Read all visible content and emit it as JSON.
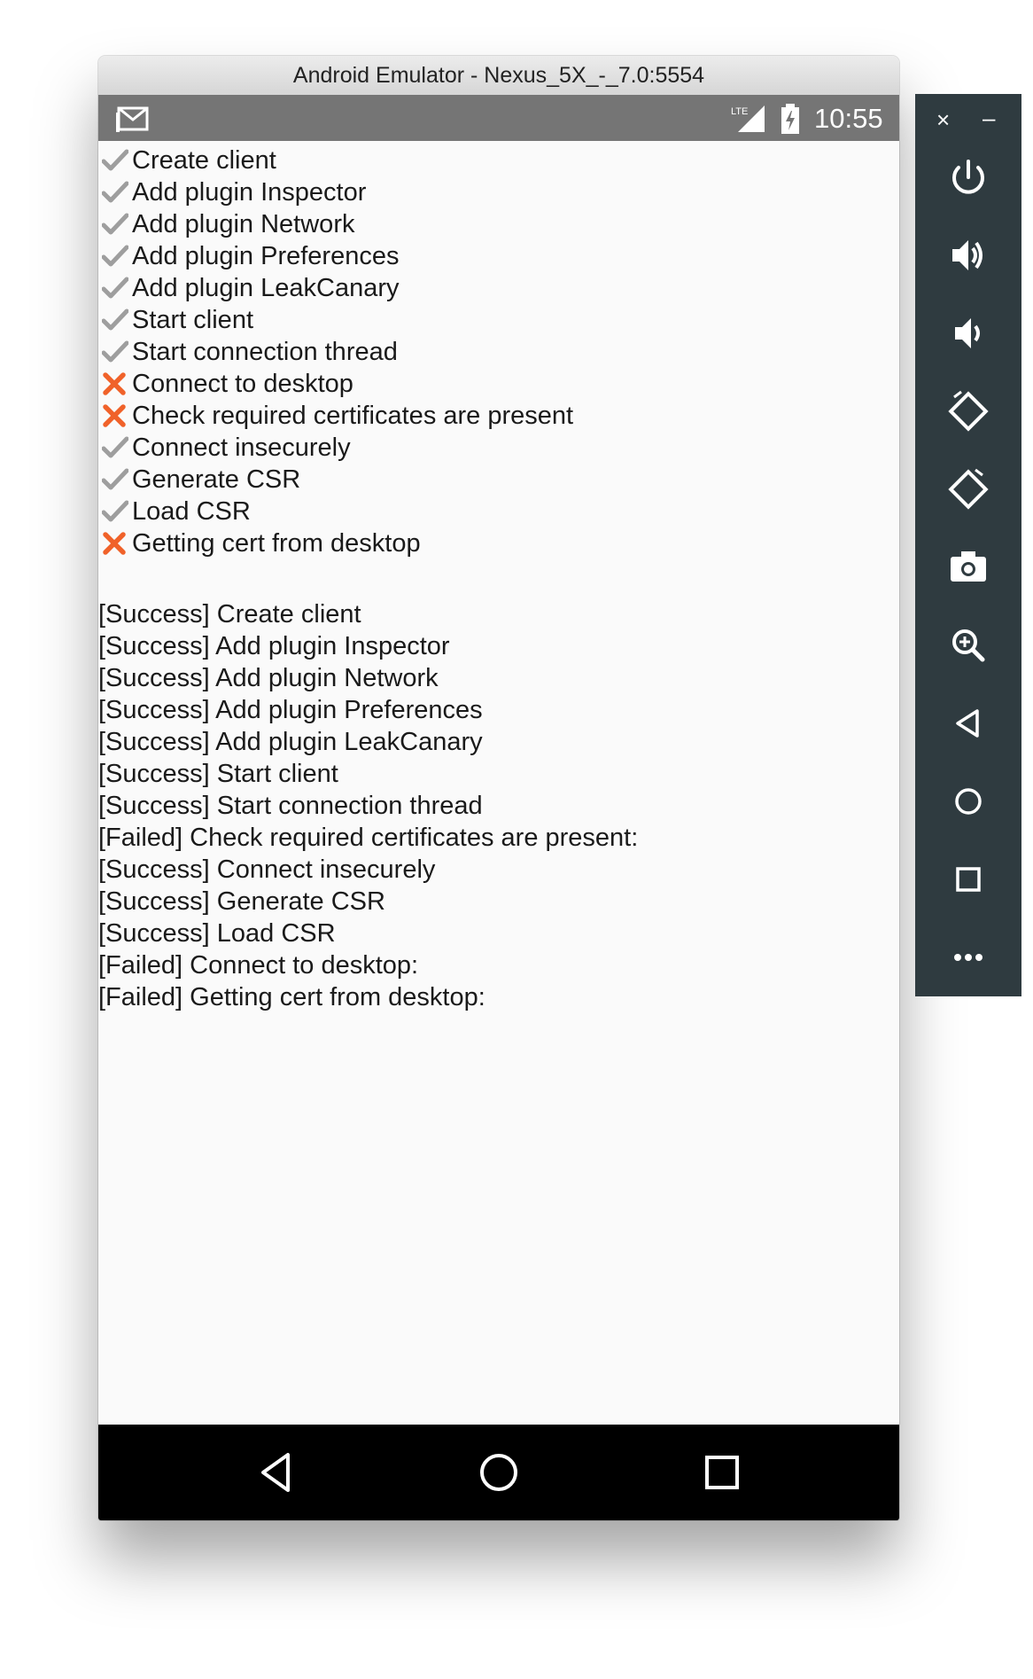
{
  "window": {
    "title": "Android Emulator - Nexus_5X_-_7.0:5554"
  },
  "statusbar": {
    "time": "10:55",
    "network": "LTE",
    "icons": [
      "message-icon",
      "lte-signal-icon",
      "battery-charging-icon"
    ]
  },
  "steps": [
    {
      "label": "Create client",
      "status": "success"
    },
    {
      "label": "Add plugin Inspector",
      "status": "success"
    },
    {
      "label": "Add plugin Network",
      "status": "success"
    },
    {
      "label": "Add plugin Preferences",
      "status": "success"
    },
    {
      "label": "Add plugin LeakCanary",
      "status": "success"
    },
    {
      "label": "Start client",
      "status": "success"
    },
    {
      "label": "Start connection thread",
      "status": "success"
    },
    {
      "label": "Connect to desktop",
      "status": "failed"
    },
    {
      "label": "Check required certificates are present",
      "status": "failed"
    },
    {
      "label": "Connect insecurely",
      "status": "success"
    },
    {
      "label": "Generate CSR",
      "status": "success"
    },
    {
      "label": "Load CSR",
      "status": "success"
    },
    {
      "label": "Getting cert from desktop",
      "status": "failed"
    }
  ],
  "log": [
    "[Success] Create client",
    "[Success] Add plugin Inspector",
    "[Success] Add plugin Network",
    "[Success] Add plugin Preferences",
    "[Success] Add plugin LeakCanary",
    "[Success] Start client",
    "[Success] Start connection thread",
    "[Failed] Check required certificates are present:",
    "[Success] Connect insecurely",
    "[Success] Generate CSR",
    "[Success] Load CSR",
    "[Failed] Connect to desktop:",
    "[Failed] Getting cert from desktop:"
  ],
  "colors": {
    "success_mark": "#9e9e9e",
    "failed_mark": "#f0622a",
    "statusbar": "#757575",
    "navbar": "#000000",
    "sidepanel": "#2f3b40"
  },
  "navbar": {
    "buttons": [
      "back-icon",
      "home-icon",
      "recents-icon"
    ]
  },
  "sidepanel": {
    "window_controls": {
      "close": "×",
      "minimize": "–"
    },
    "tools": [
      "power-icon",
      "volume-up-icon",
      "volume-down-icon",
      "rotate-left-icon",
      "rotate-right-icon",
      "camera-icon",
      "zoom-icon",
      "back-icon",
      "home-icon",
      "overview-icon",
      "more-icon"
    ]
  }
}
